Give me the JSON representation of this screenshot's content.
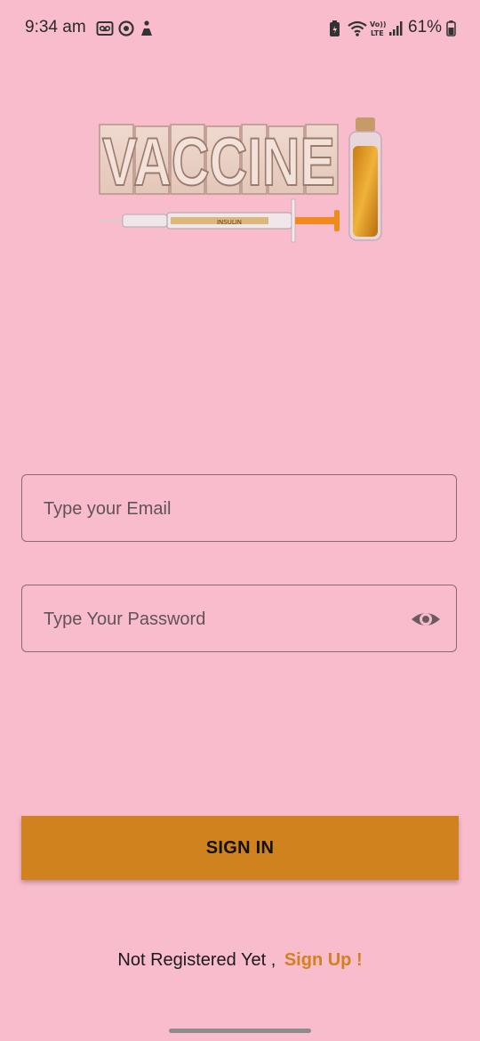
{
  "status_bar": {
    "time": "9:34 am",
    "battery": "61%"
  },
  "logo": {
    "text": "VACCINE",
    "syringe_label": "INSULIN"
  },
  "form": {
    "email_placeholder": "Type your Email",
    "password_placeholder": "Type Your Password",
    "signin_label": "SIGN IN"
  },
  "footer": {
    "prompt": "Not Registered Yet ,",
    "signup_label": "Sign Up !"
  },
  "colors": {
    "background": "#f9bccc",
    "accent": "#d0821e",
    "field_border": "#8a6a72"
  }
}
